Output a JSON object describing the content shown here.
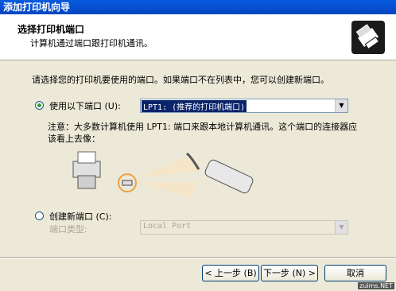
{
  "window": {
    "title": "添加打印机向导"
  },
  "header": {
    "title": "选择打印机端口",
    "subtitle": "计算机通过端口跟打印机通讯。",
    "icon": "printer-wizard-icon"
  },
  "instruction": "请选择您的打印机要使用的端口。如果端口不在列表中，您可以创建新端口。",
  "use_port": {
    "label": "使用以下端口 (U):",
    "selected": true,
    "value": "LPT1: (推荐的打印机端口)"
  },
  "note": "注意：大多数计算机使用 LPT1: 端口来跟本地计算机通讯。这个端口的连接器应该看上去像：",
  "create_port": {
    "label": "创建新端口 (C):",
    "selected": false,
    "type_label": "端口类型:",
    "type_value": "Local Port"
  },
  "buttons": {
    "back": "< 上一步 (B)",
    "next": "下一步 (N) >",
    "cancel": "取消"
  },
  "watermark": "zuims.NET"
}
